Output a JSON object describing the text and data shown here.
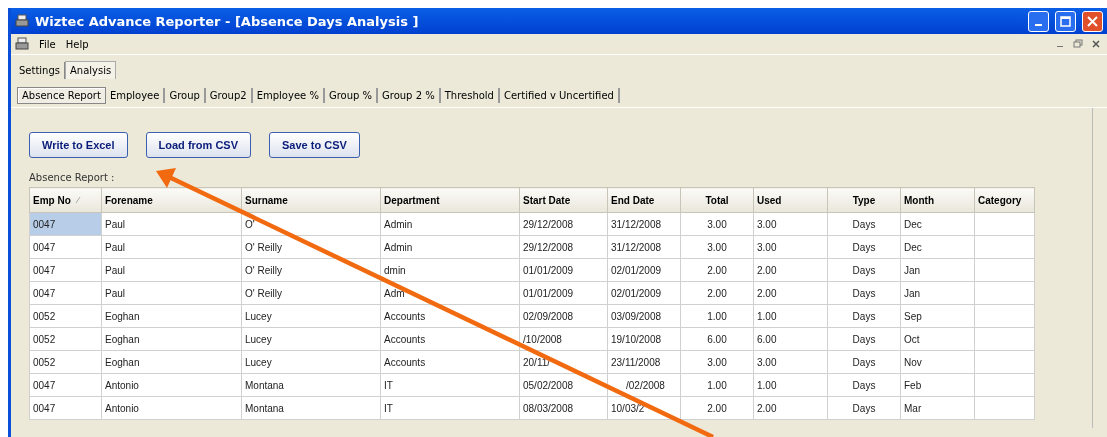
{
  "window": {
    "title": "Wiztec Advance Reporter - [Absence Days Analysis ]"
  },
  "menu": [
    "File",
    "Help"
  ],
  "outer_tabs": [
    {
      "label": "Settings",
      "selected": false
    },
    {
      "label": "Analysis",
      "selected": true
    }
  ],
  "inner_tabs": [
    {
      "label": "Absence Report",
      "selected": true
    },
    {
      "label": "Employee",
      "selected": false
    },
    {
      "label": "Group",
      "selected": false
    },
    {
      "label": "Group2",
      "selected": false
    },
    {
      "label": "Employee %",
      "selected": false
    },
    {
      "label": "Group %",
      "selected": false
    },
    {
      "label": "Group 2 %",
      "selected": false
    },
    {
      "label": "Threshold",
      "selected": false
    },
    {
      "label": "Certified v Uncertified",
      "selected": false
    }
  ],
  "buttons": [
    "Write to Excel",
    "Load from CSV",
    "Save to CSV"
  ],
  "report_label": "Absence Report :",
  "table": {
    "columns": [
      {
        "label": "Emp No",
        "sorted": true
      },
      {
        "label": "Forename",
        "sorted": false
      },
      {
        "label": "Surname",
        "sorted": false
      },
      {
        "label": "Department",
        "sorted": false
      },
      {
        "label": "Start Date",
        "sorted": false
      },
      {
        "label": "End Date",
        "sorted": false
      },
      {
        "label": "Total",
        "sorted": false
      },
      {
        "label": "Used",
        "sorted": false
      },
      {
        "label": "Type",
        "sorted": false
      },
      {
        "label": "Month",
        "sorted": false
      },
      {
        "label": "Category",
        "sorted": false
      }
    ],
    "rows": [
      {
        "selected": true,
        "cells": [
          "0047",
          "Paul",
          "O'",
          "Admin",
          "29/12/2008",
          "31/12/2008",
          "3.00",
          "3.00",
          "Days",
          "Dec",
          ""
        ]
      },
      {
        "selected": false,
        "cells": [
          "0047",
          "Paul",
          "O' Reilly",
          "Admin",
          "29/12/2008",
          "31/12/2008",
          "3.00",
          "3.00",
          "Days",
          "Dec",
          ""
        ]
      },
      {
        "selected": false,
        "cells": [
          "0047",
          "Paul",
          "O' Reilly",
          "dmin",
          "01/01/2009",
          "02/01/2009",
          "2.00",
          "2.00",
          "Days",
          "Jan",
          ""
        ]
      },
      {
        "selected": false,
        "cells": [
          "0047",
          "Paul",
          "O' Reilly",
          "Adm",
          "01/01/2009",
          "02/01/2009",
          "2.00",
          "2.00",
          "Days",
          "Jan",
          ""
        ]
      },
      {
        "selected": false,
        "cells": [
          "0052",
          "Eoghan",
          "Lucey",
          "Accounts",
          "02/09/2008",
          "03/09/2008",
          "1.00",
          "1.00",
          "Days",
          "Sep",
          ""
        ]
      },
      {
        "selected": false,
        "cells": [
          "0052",
          "Eoghan",
          "Lucey",
          "Accounts",
          "/10/2008",
          "19/10/2008",
          "6.00",
          "6.00",
          "Days",
          "Oct",
          ""
        ]
      },
      {
        "selected": false,
        "cells": [
          "0052",
          "Eoghan",
          "Lucey",
          "Accounts",
          "20/11/",
          "23/11/2008",
          "3.00",
          "3.00",
          "Days",
          "Nov",
          ""
        ]
      },
      {
        "selected": false,
        "cells": [
          "0047",
          "Antonio",
          "Montana",
          "IT",
          "05/02/2008",
          "/02/2008",
          "1.00",
          "1.00",
          "Days",
          "Feb",
          ""
        ]
      },
      {
        "selected": false,
        "cells": [
          "0047",
          "Antonio",
          "Montana",
          "IT",
          "08/03/2008",
          "10/03/2",
          "2.00",
          "2.00",
          "Days",
          "Mar",
          ""
        ]
      }
    ]
  }
}
